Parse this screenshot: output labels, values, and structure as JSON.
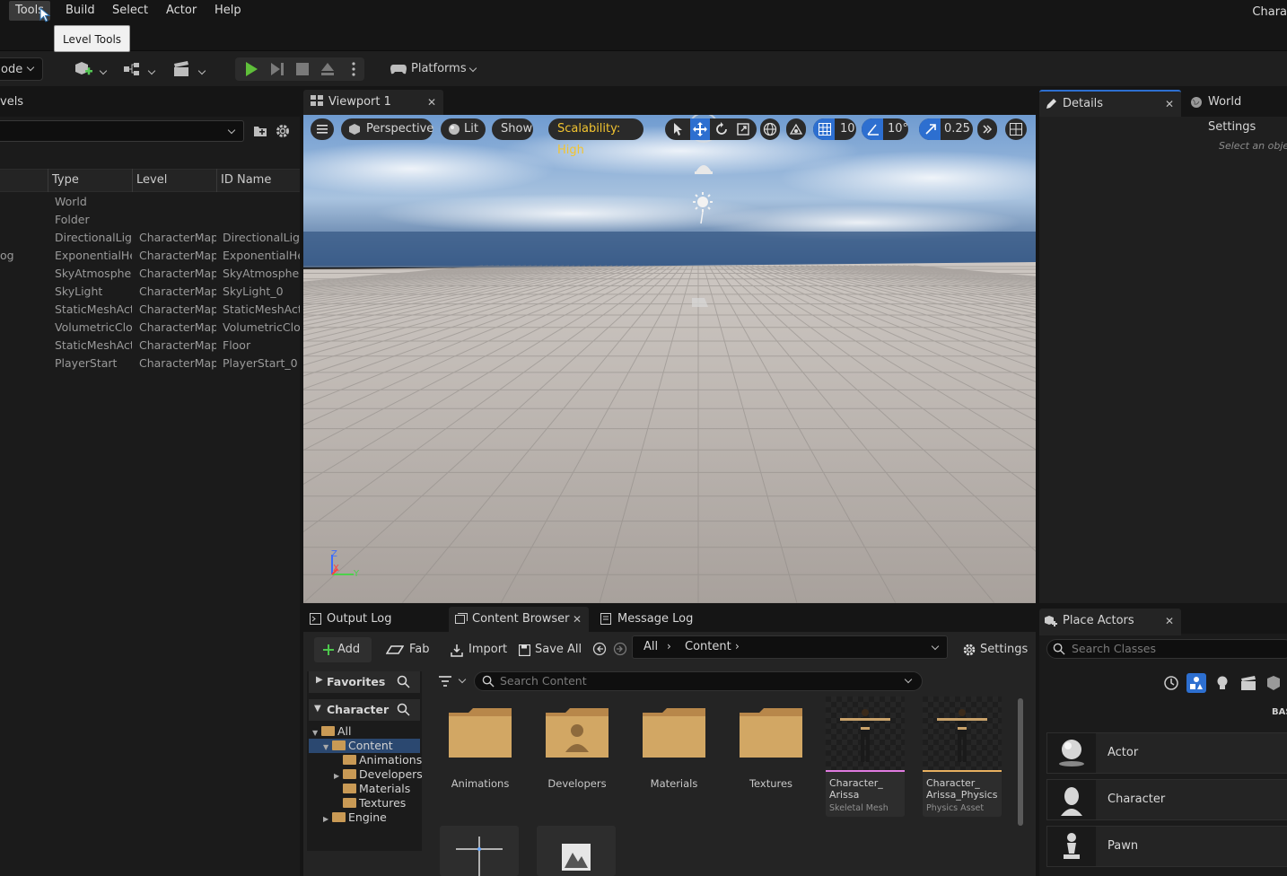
{
  "menu": {
    "items": [
      "Tools",
      "Build",
      "Select",
      "Actor",
      "Help"
    ],
    "app_title": "Chara"
  },
  "tooltip": {
    "text": "Level Tools"
  },
  "toolbar": {
    "mode_label": "ode",
    "platforms_label": "Platforms"
  },
  "outliner": {
    "tab_label": "vels",
    "columns": {
      "type": "Type",
      "level": "Level",
      "id_name": "ID Name"
    },
    "rows": [
      {
        "label": "",
        "type": "World",
        "level": "",
        "id": ""
      },
      {
        "label": "",
        "type": "Folder",
        "level": "",
        "id": ""
      },
      {
        "label": "",
        "type": "DirectionalLigh",
        "level": "CharacterMap",
        "id": "DirectionalLigh"
      },
      {
        "label": "og",
        "type": "ExponentialHei",
        "level": "CharacterMap",
        "id": "ExponentialHei"
      },
      {
        "label": "",
        "type": "SkyAtmospher",
        "level": "CharacterMap",
        "id": "SkyAtmospher"
      },
      {
        "label": "",
        "type": "SkyLight",
        "level": "CharacterMap",
        "id": "SkyLight_0"
      },
      {
        "label": "",
        "type": "StaticMeshActo",
        "level": "CharacterMap",
        "id": "StaticMeshAct"
      },
      {
        "label": "",
        "type": "VolumetricClou",
        "level": "CharacterMap",
        "id": "VolumetricClou"
      },
      {
        "label": "",
        "type": "StaticMeshActo",
        "level": "CharacterMap",
        "id": "Floor"
      },
      {
        "label": "",
        "type": "PlayerStart",
        "level": "CharacterMap",
        "id": "PlayerStart_0"
      }
    ]
  },
  "viewport": {
    "tab_label": "Viewport 1",
    "perspective": "Perspective",
    "lit": "Lit",
    "show": "Show",
    "scalability": "Scalability: High",
    "grid_snap": "10",
    "angle_snap": "10°",
    "scale_snap": "0.25",
    "axis_z": "Z",
    "axis_x": "X",
    "axis_y": "Y"
  },
  "details": {
    "tab_label": "Details",
    "world_settings_label": "World Settings",
    "empty_hint": "Select an objec"
  },
  "bottom_tabs": {
    "output_log": "Output Log",
    "content_browser": "Content Browser",
    "message_log": "Message Log"
  },
  "content_browser": {
    "add": "Add",
    "fab": "Fab",
    "import": "Import",
    "save_all": "Save All",
    "path": [
      "All",
      "Content"
    ],
    "settings": "Settings",
    "favorites": "Favorites",
    "project": "CharacterPr",
    "search_placeholder": "Search Content",
    "tree": [
      {
        "label": "All",
        "indent": 0
      },
      {
        "label": "Content",
        "indent": 1
      },
      {
        "label": "Animations",
        "indent": 2
      },
      {
        "label": "Developers",
        "indent": 2
      },
      {
        "label": "Materials",
        "indent": 2
      },
      {
        "label": "Textures",
        "indent": 2
      },
      {
        "label": "Engine",
        "indent": 1
      }
    ],
    "folders": [
      "Animations",
      "Developers",
      "Materials",
      "Textures"
    ],
    "assets": [
      {
        "name1": "Character_",
        "name2": "Arissa",
        "type": "Skeletal Mesh",
        "color": "#e07be0"
      },
      {
        "name1": "Character_",
        "name2": "Arissa_Physics",
        "type": "Physics Asset",
        "color": "#e8b060"
      }
    ]
  },
  "place_actors": {
    "tab_label": "Place Actors",
    "search_placeholder": "Search Classes",
    "section_label": "BAS",
    "items": [
      "Actor",
      "Character",
      "Pawn"
    ]
  }
}
